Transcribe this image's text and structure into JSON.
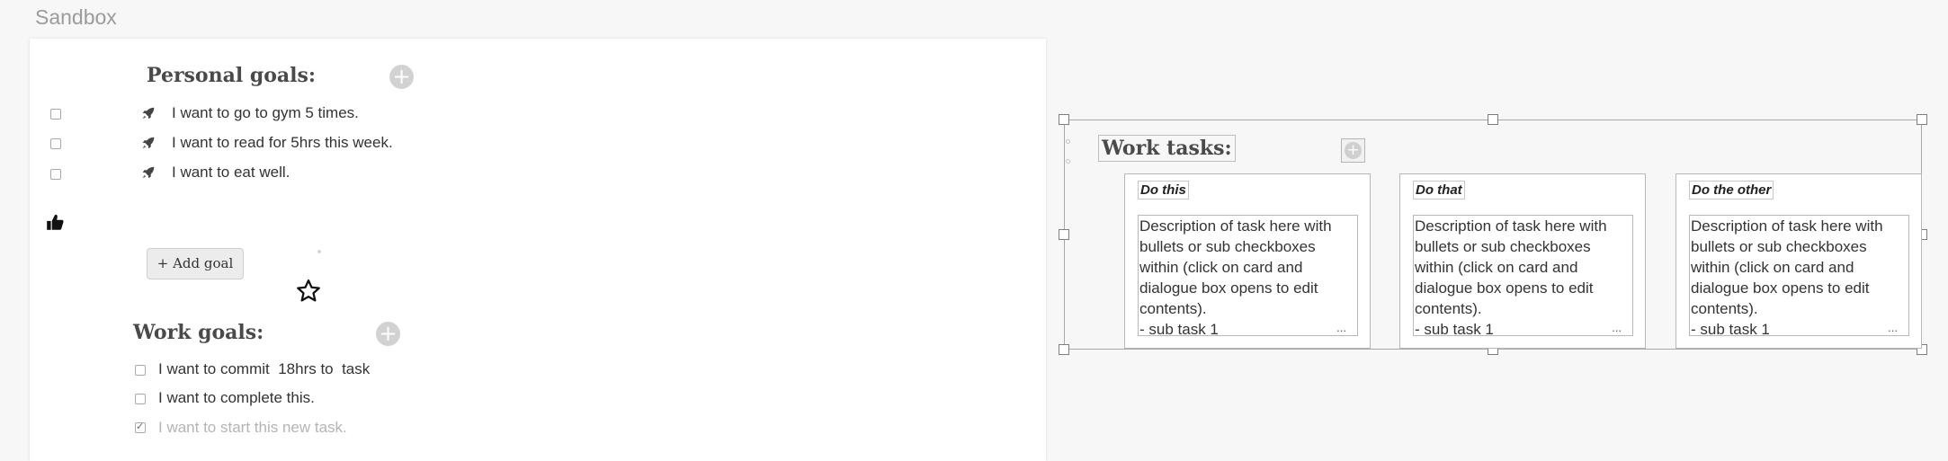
{
  "app": {
    "title": "Sandbox"
  },
  "personal": {
    "title": "Personal goals:",
    "add_symbol": "+",
    "items": [
      {
        "text": "I want to go to gym 5 times.",
        "checked": false
      },
      {
        "text": "I want to read for 5hrs this week.",
        "checked": false
      },
      {
        "text": "I want to eat well.",
        "checked": false
      }
    ],
    "add_goal_label": "+ Add goal"
  },
  "work_goals": {
    "title": "Work goals:",
    "add_symbol": "+",
    "items": [
      {
        "text": "I want to commit  18hrs to  task",
        "checked": false
      },
      {
        "text": "I want to complete this.",
        "checked": false
      },
      {
        "text": "I want to start this new task.",
        "checked": true
      }
    ]
  },
  "work_tasks": {
    "title": "Work tasks:",
    "add_symbol": "+",
    "cards": [
      {
        "title": "Do this",
        "description": "Description of task here with bullets or sub checkboxes within (click on card and dialogue box opens to edit contents).",
        "subtask": "- sub task 1",
        "more": "..."
      },
      {
        "title": "Do that",
        "description": "Description of task here with bullets or sub checkboxes within (click on card and dialogue box opens to edit contents).",
        "subtask": "- sub task 1",
        "more": "..."
      },
      {
        "title": "Do the other",
        "description": "Description of task here with bullets or sub checkboxes within (click on card and dialogue box opens to edit contents).",
        "subtask": "- sub task 1",
        "more": "..."
      }
    ]
  },
  "icons": {
    "goal_item": "rocket-icon",
    "reaction": "thumbs-up-icon",
    "favorite": "star-icon",
    "add": "plus-circle-icon"
  },
  "colors": {
    "canvas": "#f7f7f7",
    "paper": "#ffffff",
    "heading": "#4a4a4a",
    "muted_text": "#b4b4b4",
    "add_circle": "#d2d2d2"
  }
}
